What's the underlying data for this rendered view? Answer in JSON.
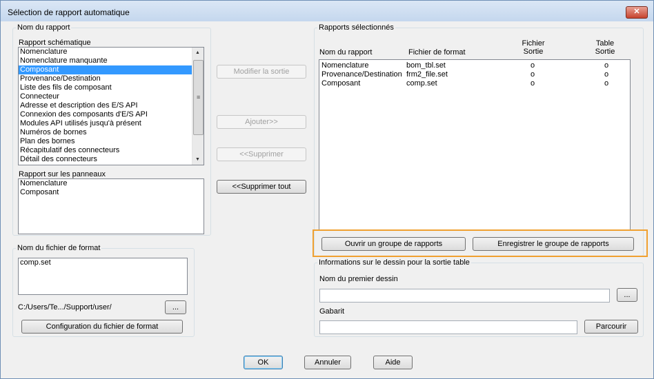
{
  "window": {
    "title": "Sélection de rapport automatique",
    "close_glyph": "✕"
  },
  "report_name": {
    "group_label": "Nom du rapport",
    "schematic_label": "Rapport schématique",
    "schematic_items": [
      "Nomenclature",
      "Nomenclature manquante",
      "Composant",
      "Provenance/Destination",
      "Liste des fils de composant",
      "Connecteur",
      "Adresse et description des E/S API",
      "Connexion des composants d'E/S API",
      "Modules API utilisés jusqu'à présent",
      "Numéros de bornes",
      "Plan des bornes",
      "Récapitulatif des connecteurs",
      "Détail des connecteurs"
    ],
    "schematic_selected_index": 2,
    "panel_label": "Rapport sur les panneaux",
    "panel_items": [
      "Nomenclature",
      "Composant"
    ]
  },
  "format_file": {
    "group_label": "Nom du fichier de format",
    "value": "comp.set",
    "path": "C:/Users/Te.../Support/user/",
    "browse_label": "...",
    "config_button": "Configuration du fichier de format"
  },
  "middle_buttons": {
    "modify": "Modifier la sortie",
    "add": "Ajouter>>",
    "remove": "<<Supprimer",
    "remove_all": "<<Supprimer tout"
  },
  "selected_reports": {
    "group_label": "Rapports sélectionnés",
    "columns": {
      "name": "Nom du rapport",
      "format": "Fichier de format",
      "file_out_1": "Fichier",
      "file_out_2": "Sortie",
      "table_out_1": "Table",
      "table_out_2": "Sortie"
    },
    "rows": [
      {
        "name": "Nomenclature",
        "format": "bom_tbl.set",
        "file": "o",
        "table": "o"
      },
      {
        "name": "Provenance/Destination",
        "format": "frm2_file.set",
        "file": "o",
        "table": "o"
      },
      {
        "name": "Composant",
        "format": "comp.set",
        "file": "o",
        "table": "o"
      }
    ],
    "open_group": "Ouvrir un groupe de rapports",
    "save_group": "Enregistrer le groupe de rapports"
  },
  "drawing_info": {
    "group_label": "Informations sur le dessin pour la sortie table",
    "first_drawing_label": "Nom du premier dessin",
    "first_drawing_value": "",
    "browse_label": "...",
    "template_label": "Gabarit",
    "template_value": "",
    "browse_template": "Parcourir"
  },
  "footer": {
    "ok": "OK",
    "cancel": "Annuler",
    "help": "Aide"
  },
  "colors": {
    "selection": "#3399ff",
    "highlight": "#f0a030"
  }
}
